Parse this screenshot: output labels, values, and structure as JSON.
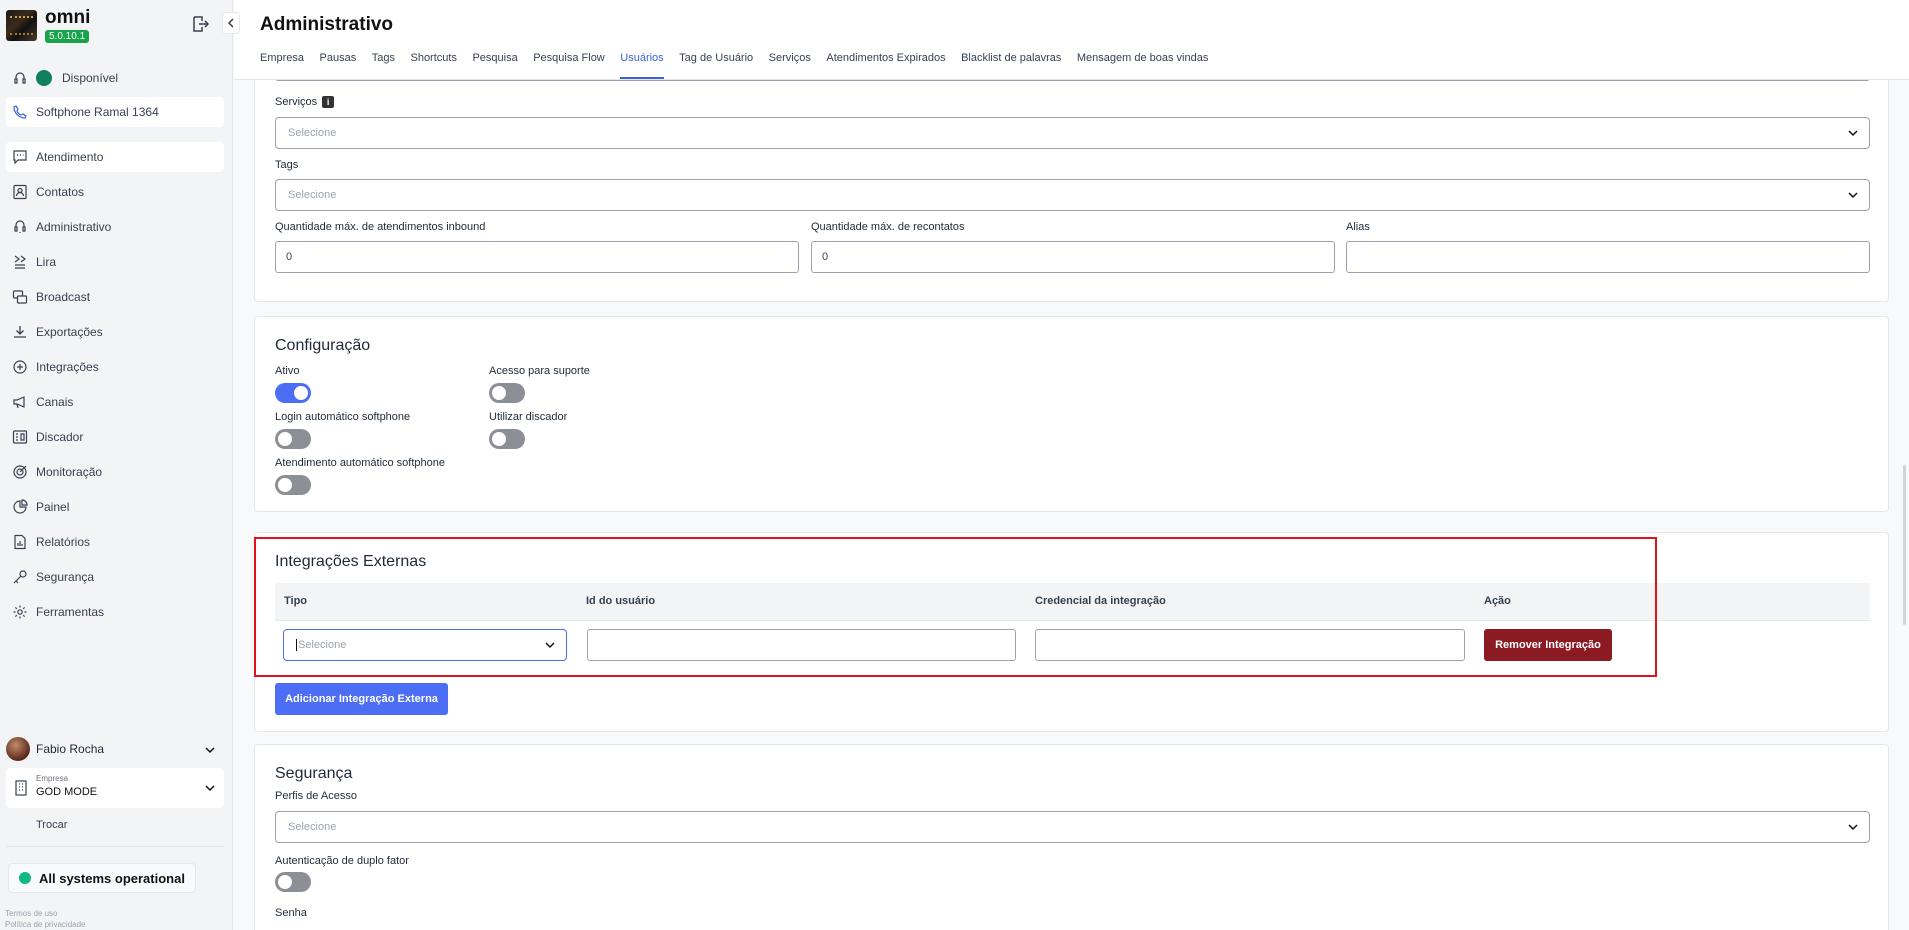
{
  "app": {
    "name": "omni",
    "version": "5.0.10.1"
  },
  "sidebar": {
    "status": "Disponível",
    "softphone": "Softphone Ramal 1364",
    "items": [
      {
        "label": "Atendimento",
        "icon": "chat-icon"
      },
      {
        "label": "Contatos",
        "icon": "contacts-icon"
      },
      {
        "label": "Administrativo",
        "icon": "admin-icon"
      },
      {
        "label": "Lira",
        "icon": "lira-icon"
      },
      {
        "label": "Broadcast",
        "icon": "broadcast-icon"
      },
      {
        "label": "Exportações",
        "icon": "download-icon"
      },
      {
        "label": "Integrações",
        "icon": "integrations-icon"
      },
      {
        "label": "Canais",
        "icon": "megaphone-icon"
      },
      {
        "label": "Discador",
        "icon": "dialer-icon"
      },
      {
        "label": "Monitoração",
        "icon": "target-icon"
      },
      {
        "label": "Painel",
        "icon": "pie-icon"
      },
      {
        "label": "Relatórios",
        "icon": "report-icon"
      },
      {
        "label": "Segurança",
        "icon": "key-icon"
      },
      {
        "label": "Ferramentas",
        "icon": "gear-icon"
      }
    ],
    "user": "Fabio Rocha",
    "company_label": "Empresa",
    "company_name": "GOD MODE",
    "switch_label": "Trocar",
    "system_status": "All systems operational",
    "terms": "Termos de uso",
    "privacy": "Política de privacidade"
  },
  "header": {
    "title": "Administrativo",
    "tabs": [
      "Empresa",
      "Pausas",
      "Tags",
      "Shortcuts",
      "Pesquisa",
      "Pesquisa Flow",
      "Usuários",
      "Tag de Usuário",
      "Serviços",
      "Atendimentos Expirados",
      "Blacklist de palavras",
      "Mensagem de boas vindas"
    ],
    "active_tab": "Usuários"
  },
  "user_form": {
    "services_label": "Serviços",
    "services_placeholder": "Selecione",
    "tags_label": "Tags",
    "tags_placeholder": "Selecione",
    "max_inbound_label": "Quantidade máx. de atendimentos inbound",
    "max_inbound_value": "0",
    "max_recontacts_label": "Quantidade máx. de recontatos",
    "max_recontacts_value": "0",
    "alias_label": "Alias",
    "alias_value": ""
  },
  "config": {
    "title": "Configuração",
    "active_label": "Ativo",
    "active": true,
    "support_label": "Acesso para suporte",
    "support": false,
    "auto_login_label": "Login automático softphone",
    "auto_login": false,
    "dialer_label": "Utilizar discador",
    "dialer": false,
    "auto_answer_label": "Atendimento automático softphone",
    "auto_answer": false
  },
  "integrations": {
    "title": "Integrações Externas",
    "columns": [
      "Tipo",
      "Id do usuário",
      "Credencial da integração",
      "Ação"
    ],
    "row": {
      "type_placeholder": "Selecione",
      "user_id": "",
      "credential": ""
    },
    "remove_label": "Remover Integração",
    "add_label": "Adicionar Integração Externa"
  },
  "security": {
    "title": "Segurança",
    "profiles_label": "Perfis de Acesso",
    "profiles_placeholder": "Selecione",
    "two_factor_label": "Autenticação de duplo fator",
    "two_factor": false,
    "password_label": "Senha"
  },
  "colors": {
    "primary": "#4c6ef5",
    "danger": "#8b1a23",
    "highlight": "#e0121b",
    "status": "#10805a"
  }
}
